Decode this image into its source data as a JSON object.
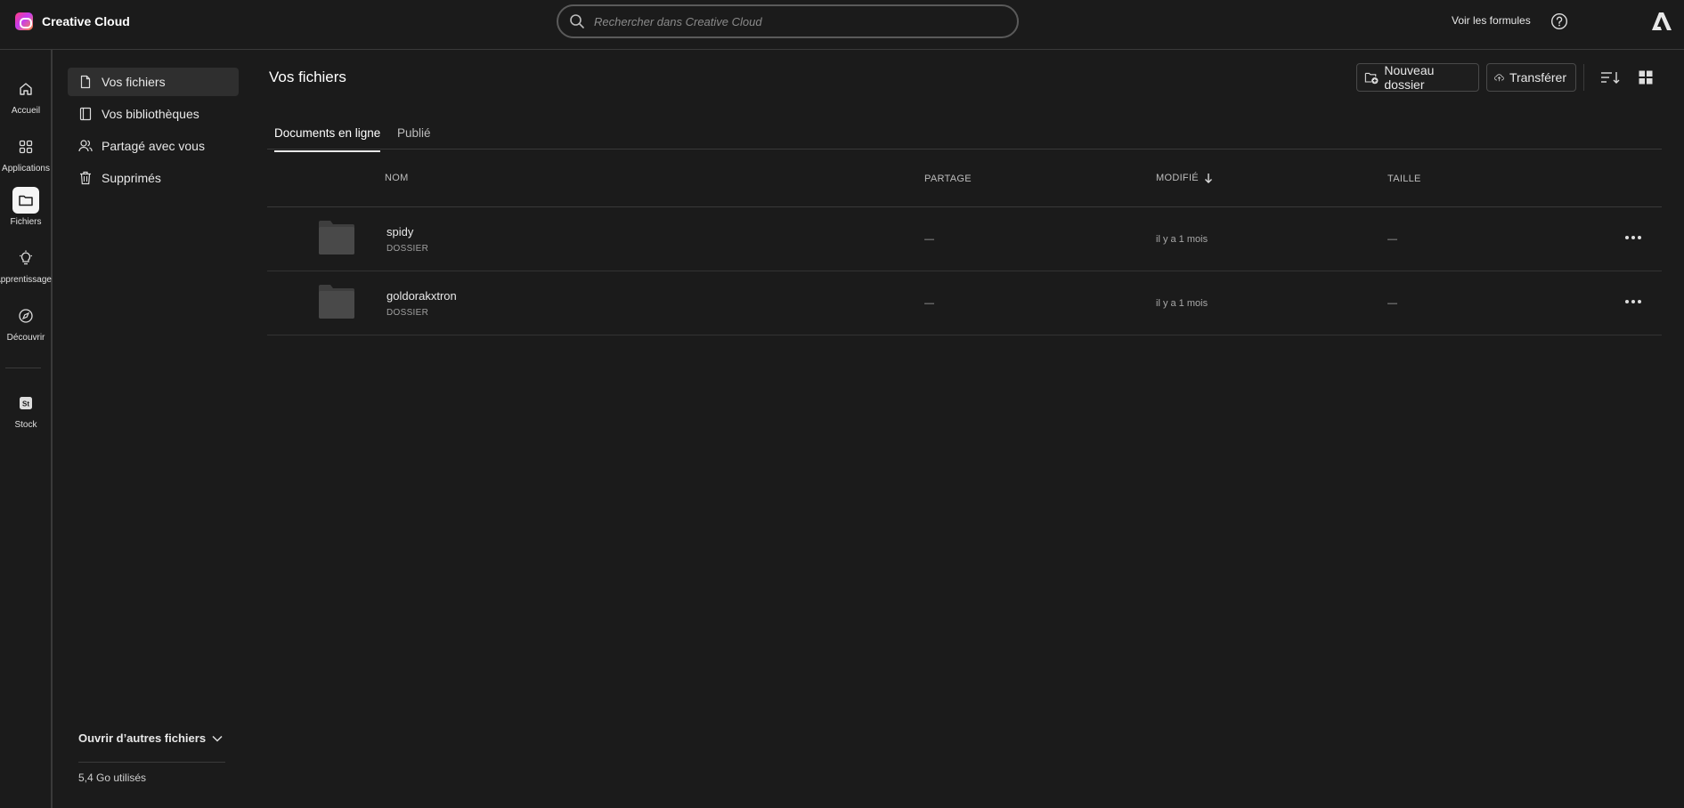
{
  "app": {
    "name": "Creative Cloud"
  },
  "search": {
    "placeholder": "Rechercher dans Creative Cloud"
  },
  "header": {
    "plans_link": "Voir les formules"
  },
  "rail": {
    "items": [
      {
        "label": "Accueil",
        "icon": "home-icon"
      },
      {
        "label": "Applications",
        "icon": "apps-icon"
      },
      {
        "label": "Fichiers",
        "icon": "folder-icon",
        "active": true
      },
      {
        "label": "Apprentissage",
        "icon": "lightbulb-icon"
      },
      {
        "label": "Découvrir",
        "icon": "compass-icon"
      },
      {
        "label": "Stock",
        "icon": "stock-icon"
      }
    ]
  },
  "subnav": {
    "items": [
      {
        "label": "Vos fichiers",
        "icon": "file-icon",
        "active": true
      },
      {
        "label": "Vos bibliothèques",
        "icon": "library-icon"
      },
      {
        "label": "Partagé avec vous",
        "icon": "shared-users-icon"
      },
      {
        "label": "Supprimés",
        "icon": "trash-icon"
      }
    ],
    "open_other": "Ouvrir d’autres fichiers",
    "storage": "5,4 Go utilisés"
  },
  "main": {
    "title": "Vos fichiers",
    "new_folder_label": "Nouveau dossier",
    "transfer_label": "Transférer",
    "tabs": [
      {
        "label": "Documents en ligne",
        "active": true
      },
      {
        "label": "Publié",
        "active": false
      }
    ],
    "columns": {
      "name": "NOM",
      "sharing": "PARTAGE",
      "modified": "MODIFIÉ",
      "size": "TAILLE"
    },
    "rows": [
      {
        "name": "spidy",
        "type": "DOSSIER",
        "sharing": "—",
        "modified": "il y a 1 mois",
        "size": "—"
      },
      {
        "name": "goldorakxtron",
        "type": "DOSSIER",
        "sharing": "—",
        "modified": "il y a 1 mois",
        "size": "—"
      }
    ]
  },
  "colors": {
    "background": "#1b1b1b",
    "active_item": "#2f2f2f",
    "border": "#3a3a3a"
  }
}
